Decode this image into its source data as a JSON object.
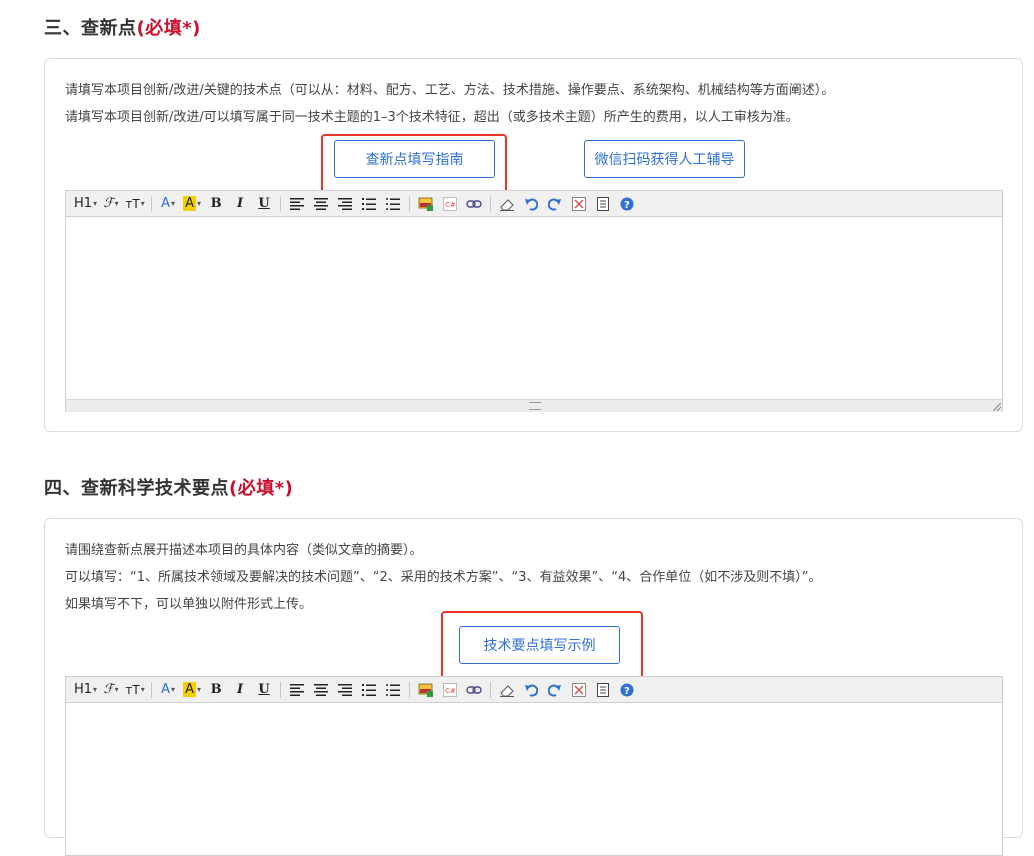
{
  "section3": {
    "title": "三、查新点",
    "required": "(必填*)",
    "desc_lines": [
      "请填写本项目创新/改进/关键的技术点（可以从：材料、配方、工艺、方法、技术措施、操作要点、系统架构、机械结构等方面阐述）。",
      "请填写本项目创新/改进/可以填写属于同一技术主题的1–3个技术特征，超出（或多技术主题）所产生的费用，以人工审核为准。"
    ],
    "guide_button": "查新点填写指南",
    "wechat_button": "微信扫码获得人工辅导"
  },
  "section4": {
    "title": "四、查新科学技术要点",
    "required": "(必填*)",
    "desc_lines": [
      "请围绕查新点展开描述本项目的具体内容（类似文章的摘要）。",
      "可以填写：“1、所属技术领域及要解决的技术问题”、“2、采用的技术方案”、“3、有益效果”、“4、合作单位（如不涉及则不填）”。",
      "如果填写不下，可以单独以附件形式上传。"
    ],
    "example_button": "技术要点填写示例"
  },
  "toolbar": {
    "heading": "H1",
    "font": "ℱ",
    "fontsize": "тT",
    "fontcolor": "A",
    "highlight": "A",
    "bold": "B",
    "italic": "I",
    "underline": "U"
  },
  "colors": {
    "accent": "#2f6fd6",
    "required": "#c8102e",
    "highlight_box": "#e8352a"
  }
}
